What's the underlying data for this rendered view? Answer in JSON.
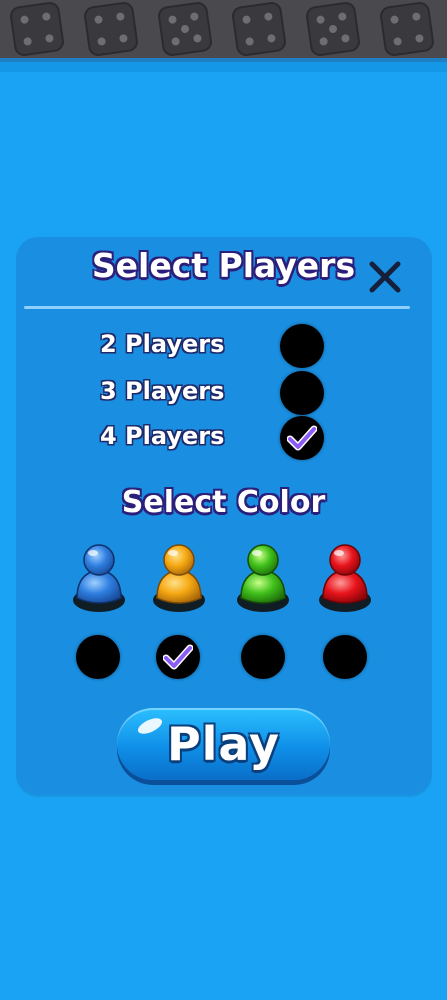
{
  "header": {
    "dice_icons": [
      "dice-four-icon",
      "dice-four-icon",
      "dice-five-icon",
      "dice-four-icon",
      "dice-five-icon",
      "dice-four-icon"
    ]
  },
  "dialog": {
    "title": "Select Players",
    "close_icon": "close-icon",
    "player_options": [
      {
        "label": "2 Players",
        "selected": false
      },
      {
        "label": "3 Players",
        "selected": false
      },
      {
        "label": "4 Players",
        "selected": true
      }
    ],
    "color_title": "Select Color",
    "colors": [
      {
        "name": "blue",
        "hex": "#2f7fe0",
        "selected": false
      },
      {
        "name": "yellow",
        "hex": "#f5a812",
        "selected": true
      },
      {
        "name": "green",
        "hex": "#3fc01a",
        "selected": false
      },
      {
        "name": "red",
        "hex": "#e8141c",
        "selected": false
      }
    ],
    "play_label": "Play"
  },
  "theme": {
    "background": "#1aa3f5",
    "panel": "#1a8ee0",
    "check_color": "#8b5cf6"
  }
}
